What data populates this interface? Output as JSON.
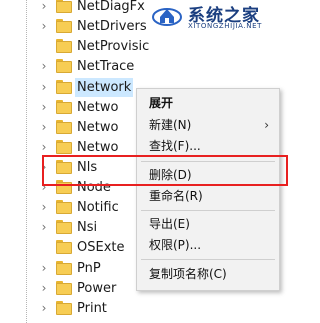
{
  "tree": {
    "items": [
      {
        "label": "NetDiagFx",
        "expander": "›",
        "selected": false
      },
      {
        "label": "NetDrivers",
        "expander": "›",
        "selected": false
      },
      {
        "label": "NetProvisic",
        "expander": "",
        "selected": false
      },
      {
        "label": "NetTrace",
        "expander": "›",
        "selected": false
      },
      {
        "label": "Network",
        "expander": "›",
        "selected": true
      },
      {
        "label": "Netwo",
        "expander": "›",
        "selected": false
      },
      {
        "label": "Netwo",
        "expander": "›",
        "selected": false
      },
      {
        "label": "Netwo",
        "expander": "›",
        "selected": false
      },
      {
        "label": "Nls",
        "expander": "›",
        "selected": false
      },
      {
        "label": "Node",
        "expander": "›",
        "selected": false
      },
      {
        "label": "Notific",
        "expander": "›",
        "selected": false
      },
      {
        "label": "Nsi",
        "expander": "›",
        "selected": false
      },
      {
        "label": "OSExte",
        "expander": "",
        "selected": false
      },
      {
        "label": "PnP",
        "expander": "›",
        "selected": false
      },
      {
        "label": "Power",
        "expander": "›",
        "selected": false
      },
      {
        "label": "Print",
        "expander": "›",
        "selected": false
      }
    ]
  },
  "context_menu": {
    "expand": "展开",
    "new": "新建(N)",
    "new_arrow": "›",
    "find": "查找(F)...",
    "delete": "删除(D)",
    "rename": "重命名(R)",
    "export": "导出(E)",
    "permissions": "权限(P)...",
    "copy_key_name": "复制项名称(C)"
  },
  "watermark": {
    "title": "系统之家",
    "url": "XITONGZHIJIA.NET"
  },
  "colors": {
    "highlight": "#e82020",
    "selection": "#cce8ff",
    "folder": "#f7cd54",
    "watermark": "#1b3f80"
  }
}
